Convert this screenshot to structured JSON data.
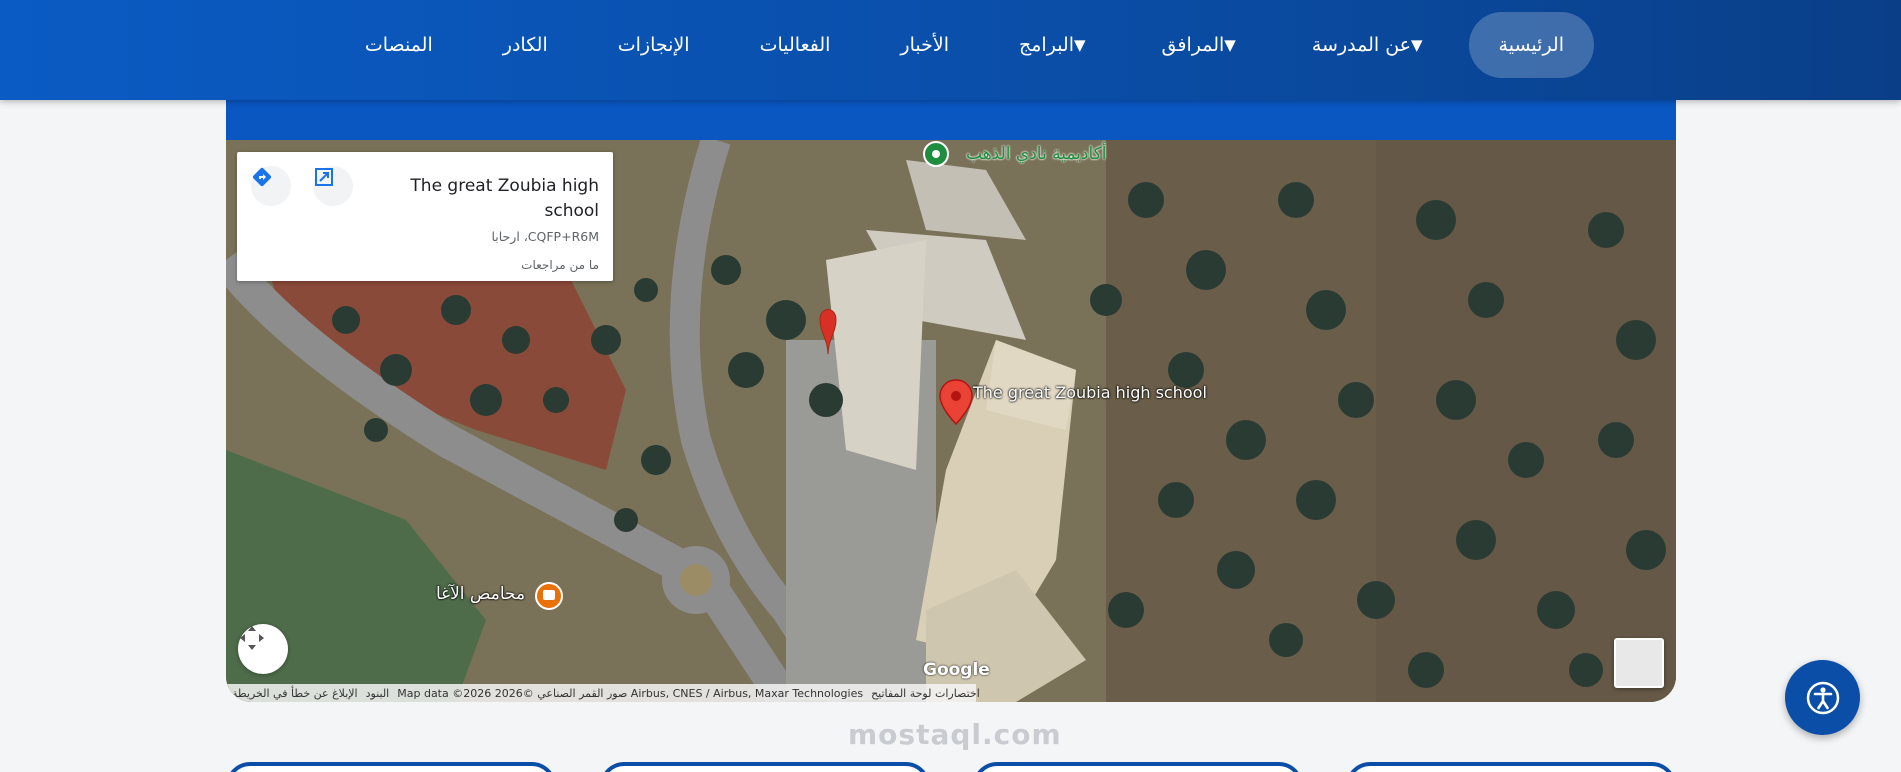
{
  "nav": {
    "items": [
      {
        "label": "الرئيسية",
        "active": true,
        "dropdown": false
      },
      {
        "label": "عن المدرسة",
        "active": false,
        "dropdown": true
      },
      {
        "label": "المرافق",
        "active": false,
        "dropdown": true
      },
      {
        "label": "البرامج",
        "active": false,
        "dropdown": true
      },
      {
        "label": "الأخبار",
        "active": false,
        "dropdown": false
      },
      {
        "label": "الفعاليات",
        "active": false,
        "dropdown": false
      },
      {
        "label": "الإنجازات",
        "active": false,
        "dropdown": false
      },
      {
        "label": "الكادر",
        "active": false,
        "dropdown": false
      },
      {
        "label": "المنصات",
        "active": false,
        "dropdown": false
      }
    ],
    "caret": "▼"
  },
  "map": {
    "info_card": {
      "title": "The great Zoubia high school",
      "address": "CQFP+R6M، ارحابا",
      "reviews": "ما من مراجعات",
      "directions_icon": "directions-icon",
      "expand_icon": "open-in-new-icon"
    },
    "pin_label": "The great Zoubia high school",
    "poi_top_label": "أكاديمية نادي الذهب",
    "poi_cafe_label": "محامص الآغا",
    "google_logo": "Google",
    "attribution": {
      "shortcuts": "اختصارات لوحة المفاتيح",
      "data": "Map data ©2026 صور القمر الصناعي ©2026 Airbus, CNES / Airbus, Maxar Technologies",
      "terms": "البنود",
      "report": "الإبلاغ عن خطأ في الخريطة"
    }
  },
  "watermark": "mostaql.com",
  "accessibility_icon": "accessibility-icon",
  "colors": {
    "header_blue": "#0a4ea8",
    "pin_red": "#d93025",
    "poi_green": "#1e8e3e",
    "cafe_orange": "#e8710a"
  }
}
